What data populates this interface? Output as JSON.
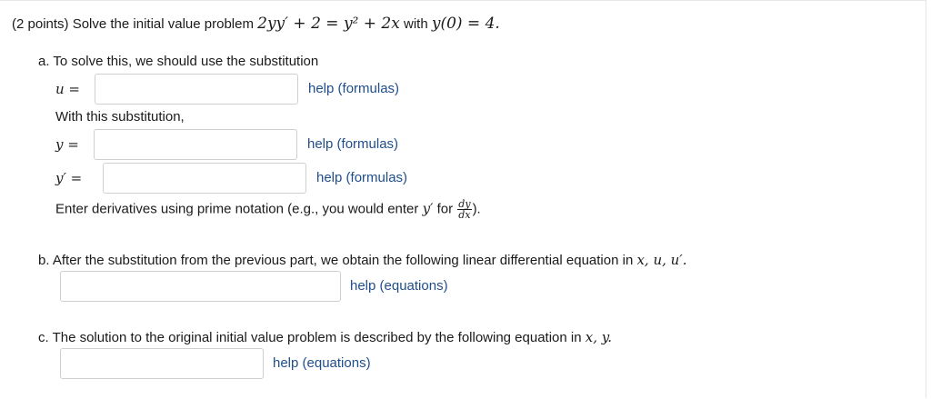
{
  "problem": {
    "intro": "(2 points) Solve the initial value problem ",
    "equation": "2yy′ + 2 = y² + 2x",
    "with_text": " with ",
    "initial_condition": "y(0) = 4."
  },
  "part_a": {
    "label": "a. To solve this, we should use the substitution",
    "u_label": "u =",
    "help_u": "help (formulas)",
    "with_sub": "With this substitution,",
    "y_label": "y =",
    "help_y": "help (formulas)",
    "yprime_label": "y′ =",
    "help_yprime": "help (formulas)",
    "note_text": "Enter derivatives using prime notation (e.g., you would enter ",
    "note_math": "y′",
    "note_for": " for ",
    "frac_num": "dy",
    "frac_den": "dx",
    "note_end": ")."
  },
  "part_b": {
    "label": "b. After the substitution from the previous part, we obtain the following linear differential equation in ",
    "vars": "x, u, u′.",
    "help": "help (equations)"
  },
  "part_c": {
    "label": "c. The solution to the original initial value problem is described by the following equation in ",
    "vars": "x, y.",
    "help": "help (equations)"
  },
  "inputs": {
    "u_value": "",
    "y_value": "",
    "yprime_value": "",
    "b_value": "",
    "c_value": ""
  }
}
